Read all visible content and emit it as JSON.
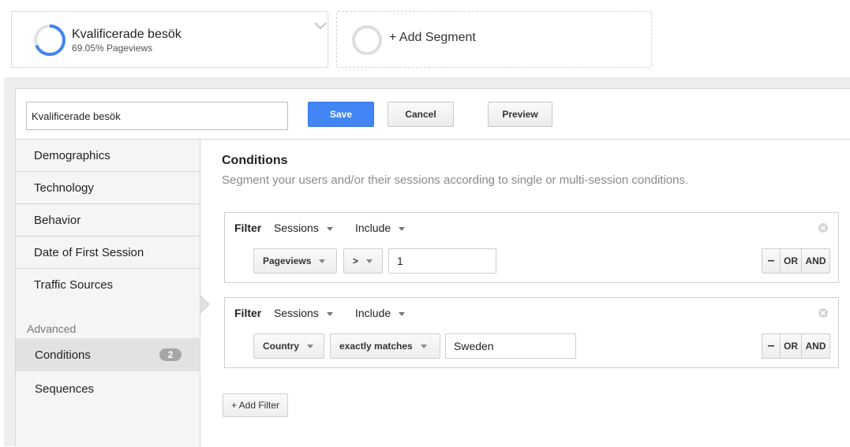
{
  "active_segment": {
    "title": "Kvalificerade besök",
    "subtitle": "69.05% Pageviews",
    "percent": 0.6905,
    "ring_color": "#4285f4",
    "icon": "chevron-down-icon"
  },
  "add_segment": {
    "label": "+ Add Segment"
  },
  "toolbar": {
    "segment_name_value": "Kvalificerade besök",
    "save_label": "Save",
    "cancel_label": "Cancel",
    "preview_label": "Preview",
    "save_color": "#4285f4"
  },
  "sidebar": {
    "items": [
      {
        "label": "Demographics"
      },
      {
        "label": "Technology"
      },
      {
        "label": "Behavior"
      },
      {
        "label": "Date of First Session"
      },
      {
        "label": "Traffic Sources"
      }
    ],
    "advanced_label": "Advanced",
    "conditions": {
      "label": "Conditions",
      "count": "2"
    },
    "sequences": {
      "label": "Sequences"
    }
  },
  "main": {
    "title": "Conditions",
    "description": "Segment your users and/or their sessions according to single or multi-session conditions.",
    "filters": [
      {
        "label": "Filter",
        "scope": "Sessions",
        "mode": "Include",
        "dimension": "Pageviews",
        "operator": ">",
        "value": "1",
        "logic": {
          "minus": "–",
          "or": "OR",
          "and": "AND"
        }
      },
      {
        "label": "Filter",
        "scope": "Sessions",
        "mode": "Include",
        "dimension": "Country",
        "operator": "exactly matches",
        "value": "Sweden",
        "logic": {
          "minus": "–",
          "or": "OR",
          "and": "AND"
        }
      }
    ],
    "add_filter_label": "+ Add Filter"
  }
}
